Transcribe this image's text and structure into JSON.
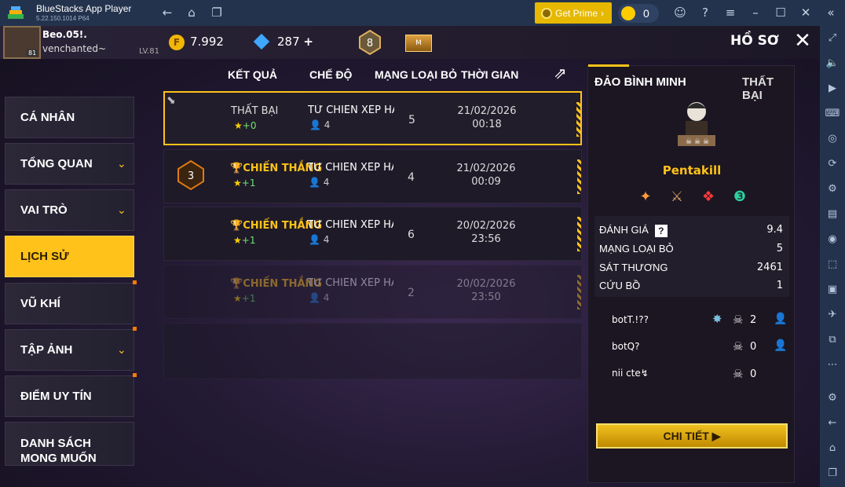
{
  "emulator": {
    "title": "BlueStacks App Player",
    "version": "5.22.150.1014  P64",
    "get_prime_label": "Get Prime",
    "coin_count": "0"
  },
  "player": {
    "name": "Beo.05!.",
    "subtitle": "venchanted~",
    "level": "LV.81",
    "avatar_level": "81"
  },
  "currency": {
    "gold": "7.992",
    "diamonds": "287"
  },
  "rank_badge": "8",
  "header": {
    "title": "HỒ SƠ"
  },
  "menu": [
    {
      "label": "CÁ NHÂN"
    },
    {
      "label": "TỔNG QUAN"
    },
    {
      "label": "VAI TRÒ"
    },
    {
      "label": "LỊCH SỬ"
    },
    {
      "label": "VŨ KHÍ"
    },
    {
      "label": "TẬP ẢNH"
    },
    {
      "label": "ĐIỂM UY TÍN"
    },
    {
      "label": "DANH SÁCH\nMONG MUỐN"
    }
  ],
  "table": {
    "headers": [
      "KẾT QUẢ",
      "CHẾ ĐỘ",
      "MẠNG LOẠI BỎ",
      "THỜI GIAN"
    ],
    "rows": [
      {
        "result": "THẤT BẠI",
        "points": "+0",
        "mode": "TỬ CHIẾN XẾP HẠ",
        "squad": "4",
        "kills": "5",
        "date": "21/02/2026",
        "time": "00:18"
      },
      {
        "result": "CHIẾN THẮNG",
        "points": "+1",
        "mode": "TỬ CHIẾN XẾP HẠ",
        "squad": "4",
        "kills": "4",
        "date": "21/02/2026",
        "time": "00:09",
        "booyah": "3"
      },
      {
        "result": "CHIẾN THẮNG",
        "points": "+1",
        "mode": "TỬ CHIẾN XẾP HẠ",
        "squad": "4",
        "kills": "6",
        "date": "20/02/2026",
        "time": "23:56"
      },
      {
        "result": "CHIẾN THẮNG",
        "points": "+1",
        "mode": "TỬ CHIẾN XẾP HẠ",
        "squad": "4",
        "kills": "2",
        "date": "20/02/2026",
        "time": "23:50"
      }
    ]
  },
  "detail": {
    "map": "ĐẢO BÌNH MINH",
    "outcome": "THẤT BẠI",
    "title": "Pentakill",
    "stats": [
      {
        "label": "ĐÁNH GIÁ",
        "value": "9.4"
      },
      {
        "label": "MẠNG LOẠI BỎ",
        "value": "5"
      },
      {
        "label": "SÁT THƯƠNG",
        "value": "2461"
      },
      {
        "label": "CỨU BỒ",
        "value": "1"
      }
    ],
    "teammates": [
      {
        "name": "botT.!??",
        "kills": "2"
      },
      {
        "name": "botQ?",
        "kills": "0"
      },
      {
        "name": "nii cte↯",
        "kills": "0"
      }
    ],
    "button": "CHI TIẾT ▶"
  },
  "colors": {
    "accent": "#ffc21a",
    "win_text": "#ffc21a",
    "points_green": "#6fe36f",
    "emulator_bar": "#24334d"
  }
}
